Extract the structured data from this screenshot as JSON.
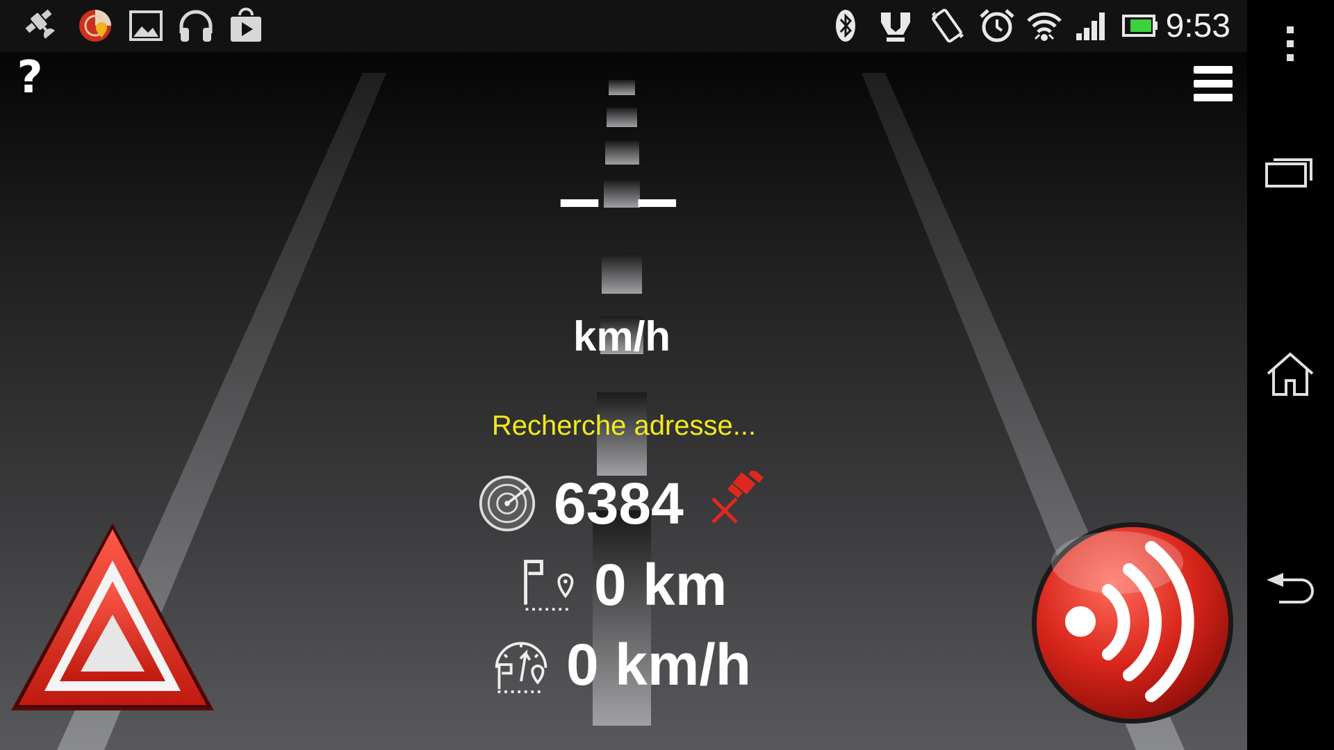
{
  "status_bar": {
    "clock": "9:53",
    "left_icons": [
      "satellite-icon",
      "radar-app-icon",
      "gallery-icon",
      "headphones-icon",
      "play-store-icon"
    ],
    "right_icons": [
      "bluetooth-icon",
      "nfc-icon",
      "vibrate-icon",
      "alarm-icon",
      "wifi-icon",
      "signal-icon",
      "battery-icon"
    ]
  },
  "app": {
    "help_label": "?",
    "speed_value": "– –",
    "speed_unit": "km/h",
    "address_status": "Recherche adresse...",
    "radar_count": "6384",
    "trip_distance": "0 km",
    "average_speed": "0 km/h",
    "colors": {
      "address_status": "#f2ea1c",
      "alert_red": "#d9261c",
      "gps_off": "#e0281e"
    }
  },
  "nav_bar": {
    "buttons": [
      "overflow-menu",
      "recent-apps",
      "home",
      "back"
    ]
  }
}
